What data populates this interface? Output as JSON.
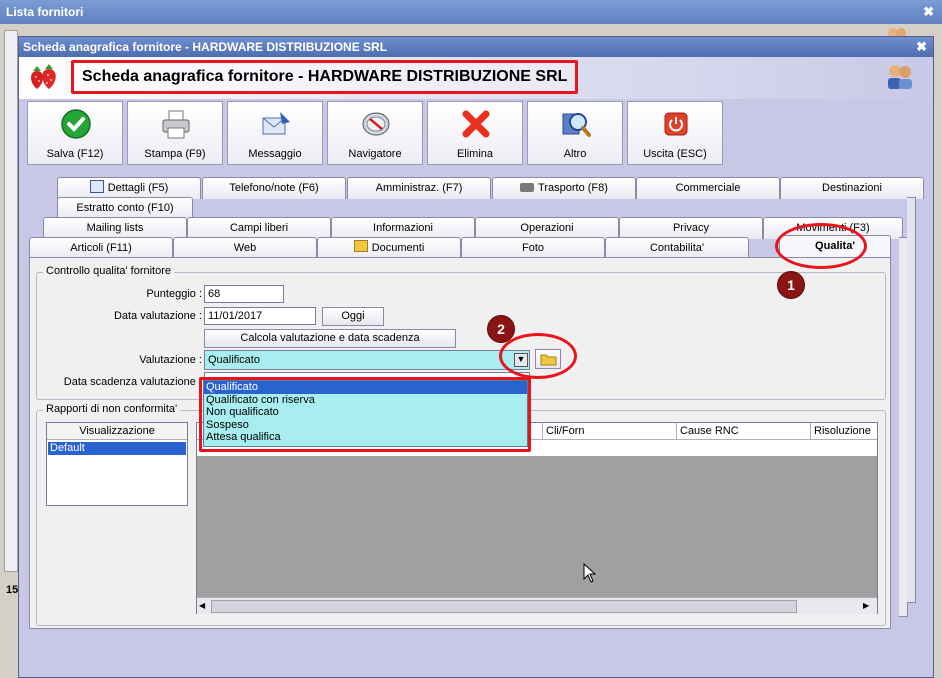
{
  "background_window": {
    "title": "Lista fornitori",
    "status_number": "15"
  },
  "dialog": {
    "title": "Scheda anagrafica fornitore - HARDWARE DISTRIBUZIONE SRL",
    "header_title": "Scheda anagrafica fornitore - HARDWARE DISTRIBUZIONE SRL"
  },
  "toolbar": [
    {
      "label": "Salva (F12)",
      "icon": "save-check-icon"
    },
    {
      "label": "Stampa (F9)",
      "icon": "printer-icon"
    },
    {
      "label": "Messaggio",
      "icon": "envelope-icon"
    },
    {
      "label": "Navigatore",
      "icon": "compass-icon"
    },
    {
      "label": "Elimina",
      "icon": "delete-x-icon"
    },
    {
      "label": "Altro",
      "icon": "magnifier-icon"
    },
    {
      "label": "Uscita (ESC)",
      "icon": "power-icon"
    }
  ],
  "tabs_row1": [
    "Dettagli (F5)",
    "Telefono/note (F6)",
    "Amministraz. (F7)",
    "Trasporto (F8)",
    "Commerciale",
    "Destinazioni",
    "Estratto conto (F10)"
  ],
  "tabs_row2": [
    "Mailing lists",
    "Campi liberi",
    "Informazioni",
    "Operazioni",
    "Privacy",
    "Movimenti (F3)"
  ],
  "tabs_row3": [
    "Articoli (F11)",
    "Web",
    "Documenti",
    "Foto",
    "Contabilita'",
    "Qualita'"
  ],
  "quality": {
    "group_title": "Controllo qualita' fornitore",
    "punteggio_label": "Punteggio :",
    "punteggio_value": "68",
    "data_val_label": "Data valutazione :",
    "data_val_value": "11/01/2017",
    "oggi_label": "Oggi",
    "calcola_label": "Calcola valutazione e data scadenza",
    "valutazione_label": "Valutazione :",
    "valutazione_value": "Qualificato",
    "scadenza_label": "Data scadenza valutazione :",
    "options": [
      "Qualificato",
      "Qualificato con riserva",
      "Non qualificato",
      "Sospeso",
      "Attesa qualifica"
    ]
  },
  "rnc": {
    "group_title": "Rapporti di non conformita'",
    "view_header": "Visualizzazione",
    "view_items": [
      "Default"
    ],
    "columns": [
      "Cli/Forn",
      "Cause RNC",
      "Risoluzione"
    ]
  },
  "callouts": [
    "1",
    "2"
  ],
  "colors": {
    "accent_red": "#e8141c",
    "selection_blue": "#2a62d0",
    "dropdown_cyan": "#a8eef0"
  }
}
